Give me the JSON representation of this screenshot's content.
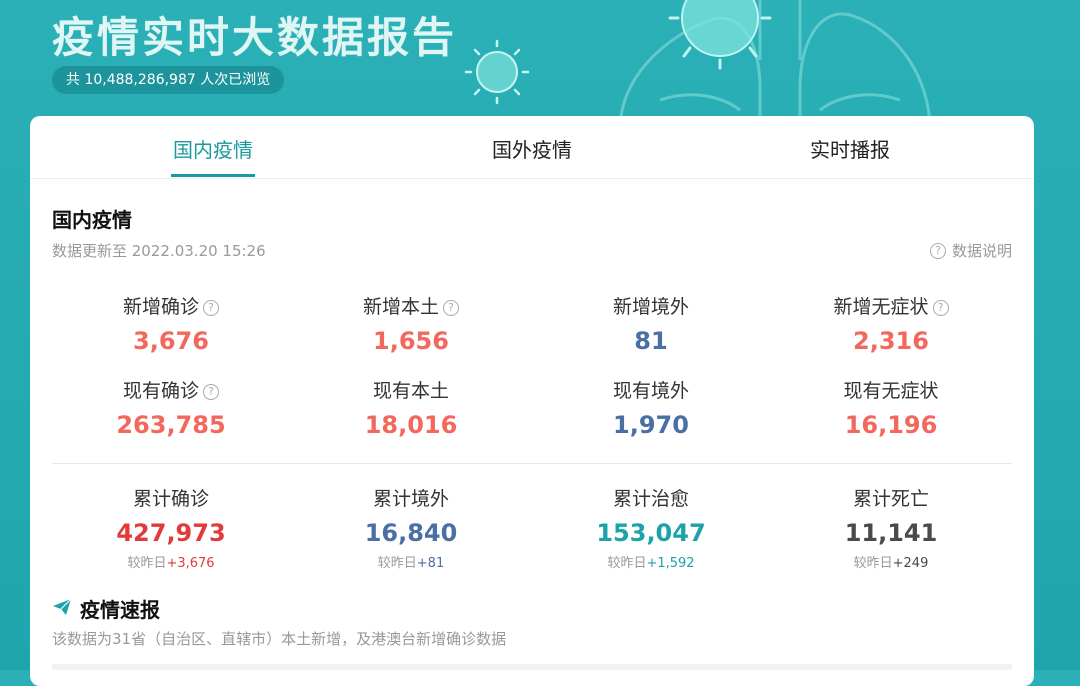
{
  "hero": {
    "title": "疫情实时大数据报告",
    "views_text": "共 10,488,286,987 人次已浏览"
  },
  "tabs": [
    {
      "label": "国内疫情",
      "active": true
    },
    {
      "label": "国外疫情",
      "active": false
    },
    {
      "label": "实时播报",
      "active": false
    }
  ],
  "section": {
    "title": "国内疫情",
    "updated": "数据更新至 2022.03.20 15:26",
    "data_note": "数据说明"
  },
  "stats": {
    "new_confirmed": {
      "label": "新增确诊",
      "value": "3,676",
      "color": "#f2685c"
    },
    "new_local": {
      "label": "新增本土",
      "value": "1,656",
      "color": "#f2685c"
    },
    "new_imported": {
      "label": "新增境外",
      "value": "81",
      "color": "#4a6fa5"
    },
    "new_asymptomatic": {
      "label": "新增无症状",
      "value": "2,316",
      "color": "#f2685c"
    },
    "current_confirmed": {
      "label": "现有确诊",
      "value": "263,785",
      "color": "#f2685c"
    },
    "current_local": {
      "label": "现有本土",
      "value": "18,016",
      "color": "#f2685c"
    },
    "current_imported": {
      "label": "现有境外",
      "value": "1,970",
      "color": "#4a6fa5"
    },
    "current_asymptomatic": {
      "label": "现有无症状",
      "value": "16,196",
      "color": "#f2685c"
    }
  },
  "totals": {
    "confirmed": {
      "label": "累计确诊",
      "value": "427,973",
      "cmp_prefix": "较昨日",
      "cmp_delta": "+3,676",
      "color": "#e13a3a"
    },
    "imported": {
      "label": "累计境外",
      "value": "16,840",
      "cmp_prefix": "较昨日",
      "cmp_delta": "+81",
      "color": "#4a6fa5"
    },
    "cured": {
      "label": "累计治愈",
      "value": "153,047",
      "cmp_prefix": "较昨日",
      "cmp_delta": "+1,592",
      "color": "#1aa3a8"
    },
    "deaths": {
      "label": "累计死亡",
      "value": "11,141",
      "cmp_prefix": "较昨日",
      "cmp_delta": "+249",
      "color": "#4a4a4a"
    }
  },
  "brief": {
    "title": "疫情速报",
    "description": "该数据为31省（自治区、直辖市）本土新增，及港澳台新增确诊数据",
    "icon": "paper-plane-icon"
  },
  "colors": {
    "accent": "#1a9aa0",
    "background": "#2ab0b6"
  }
}
